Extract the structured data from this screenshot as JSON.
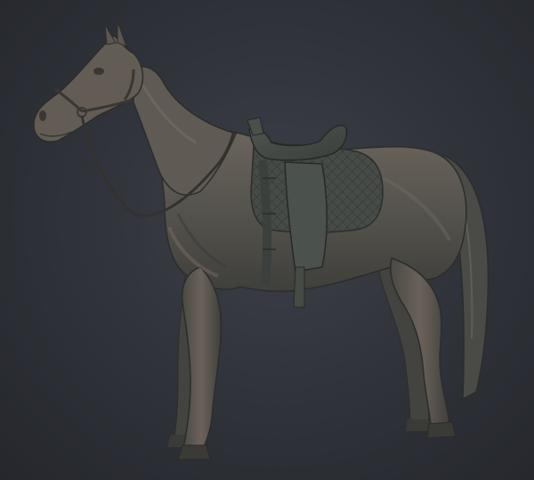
{
  "viewport": {
    "background_color": "#2f3238",
    "background_edge_color": "#23252b"
  },
  "model": {
    "subject": "horse-sculpt-with-saddle-and-bridle",
    "material_color": "#5a5a55",
    "shadow_color": "#3f403d",
    "highlight_color": "#8a7468"
  }
}
